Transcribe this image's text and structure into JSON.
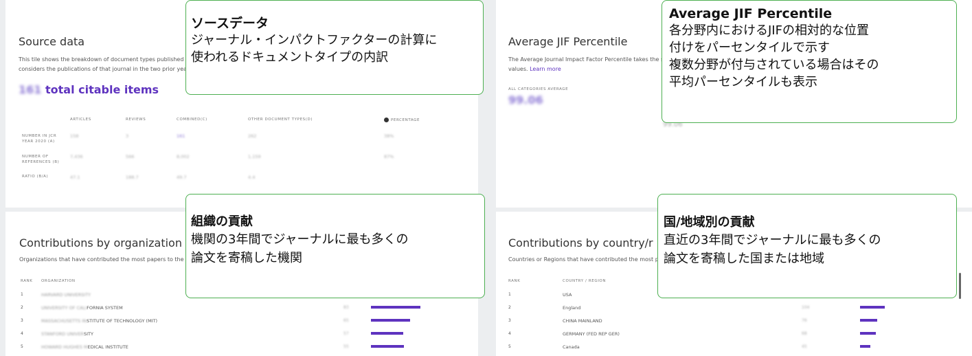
{
  "source": {
    "title": "Source data",
    "desc1": "This tile shows the breakdown of document types published b",
    "desc2": "considers the publications of that journal in the two prior yea",
    "total_count": "161",
    "total_label": "total citable items",
    "columns": [
      "ARTICLES",
      "REVIEWS",
      "COMBINED(C)",
      "OTHER DOCUMENT TYPES(D)",
      "PERCENTAGE"
    ],
    "rows": [
      {
        "label": "NUMBER IN JCR YEAR 2020 (A)",
        "values": [
          "158",
          "3",
          "161",
          "262",
          "38%"
        ]
      },
      {
        "label": "NUMBER OF REFERENCES (B)",
        "values": [
          "7,436",
          "566",
          "8,002",
          "1,159",
          "87%"
        ]
      },
      {
        "label": "RATIO (B/A)",
        "values": [
          "47.1",
          "188.7",
          "49.7",
          "4.4"
        ]
      }
    ]
  },
  "average": {
    "title": "Average JIF Percentile",
    "desc": "The Average Journal Impact Factor Percentile takes the s",
    "desc2": "values.",
    "learn_more": "Learn more",
    "all_label": "ALL CATEGORIES AVERAGE",
    "all_value": "99.06",
    "sub_value": "99.06"
  },
  "organizations": {
    "title": "Contributions by organization",
    "desc": "Organizations that have contributed the most papers to the jo",
    "col_rank": "RANK",
    "col_name": "ORGANIZATION",
    "rows": [
      {
        "rank": "1",
        "blurred": "HARVARD UNIVERSITY",
        "name": "",
        "count": "",
        "bar": 0
      },
      {
        "rank": "2",
        "blurred": "UNIVERSITY OF CALI",
        "name": "FORNIA SYSTEM",
        "count": "83",
        "bar": 0.86
      },
      {
        "rank": "3",
        "blurred": "MASSACHUSETTS IN",
        "name": "STITUTE OF TECHNOLOGY (MIT)",
        "count": "65",
        "bar": 0.68
      },
      {
        "rank": "4",
        "blurred": "STANFORD UNIVER",
        "name": "SITY",
        "count": "57",
        "bar": 0.56
      },
      {
        "rank": "5",
        "blurred": "HOWARD HUGHES M",
        "name": "EDICAL INSTITUTE",
        "count": "55",
        "bar": 0.57
      }
    ]
  },
  "countries": {
    "title": "Contributions by country/r",
    "desc": "Countries or Regions that have contributed the most pap",
    "col_rank": "RANK",
    "col_name": "COUNTRY / REGION",
    "rows": [
      {
        "rank": "1",
        "name": "USA",
        "count": "",
        "bar": 0
      },
      {
        "rank": "2",
        "name": "England",
        "count": "104",
        "bar": 0.43
      },
      {
        "rank": "3",
        "name": "CHINA MAINLAND",
        "count": "76",
        "bar": 0.3
      },
      {
        "rank": "4",
        "name": "GERMANY (FED REP GER)",
        "count": "68",
        "bar": 0.27
      },
      {
        "rank": "5",
        "name": "Canada",
        "count": "45",
        "bar": 0.18
      }
    ]
  },
  "callouts": {
    "source": {
      "title": "ソースデータ",
      "body": "ジャーナル・インパクトファクターの計算に\n使われるドキュメントタイプの内訳"
    },
    "average": {
      "title": "Average JIF Percentile",
      "body": "各分野内におけるJIFの相対的な位置\n付けをパーセンタイルで示す\n複数分野が付与されている場合はその\n平均パーセンタイルも表示"
    },
    "org": {
      "title": "組織の貢献",
      "body": "機関の3年間でジャーナルに最も多くの\n論文を寄稿した機関"
    },
    "country": {
      "title": "国/地域別の貢献",
      "body": "直近の3年間でジャーナルに最も多くの\n論文を寄稿した国または地域"
    }
  },
  "colors": {
    "accent": "#5e33bf",
    "callout_border": "#4caf50"
  }
}
